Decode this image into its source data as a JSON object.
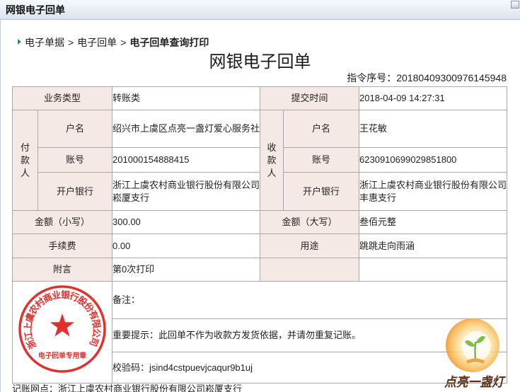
{
  "window": {
    "title": "网银电子回单",
    "control_icon": "window-control-icon"
  },
  "breadcrumb": {
    "items": [
      "电子单据",
      "电子回单"
    ],
    "separator": ">",
    "current": "电子回单查询打印"
  },
  "receipt": {
    "title": "网银电子回单",
    "instruction_label": "指令序号：",
    "instruction_no": "20180409300976145948",
    "business_type": {
      "label": "业务类型",
      "value": "转账类"
    },
    "submit_time": {
      "label": "提交时间",
      "value": "2018-04-09 14:27:31"
    },
    "payer": {
      "label": "付款人",
      "name_label": "户名",
      "name": "绍兴市上虞区点亮一盏灯爱心服务社",
      "account_label": "账号",
      "account": "201000154888415",
      "bank_label": "开户银行",
      "bank": "浙江上虞农村商业银行股份有限公司崧厦支行"
    },
    "payee": {
      "label": "收款人",
      "name_label": "户名",
      "name": "王花敏",
      "account_label": "账号",
      "account": "6230910699029851800",
      "bank_label": "开户银行",
      "bank": "浙江上虞农村商业银行股份有限公司丰惠支行"
    },
    "amount_lower": {
      "label": "金额（小写）",
      "value": "300.00"
    },
    "amount_upper": {
      "label": "金额（大写）",
      "value": "叁佰元整"
    },
    "fee": {
      "label": "手续费",
      "value": "0.00"
    },
    "purpose": {
      "label": "用途",
      "value": "跳跳走向雨涵"
    },
    "postscript": {
      "label": "附言",
      "value": "第0次打印"
    },
    "remark_label": "备注：",
    "notice": "重要提示：此回单不作为收款方发货依据，并请勿重复记账。",
    "check_code_label": "校验码：",
    "check_code": "jsind4cstpuevjcaqur9b1uj",
    "seal": {
      "ring_text": "浙江上虞农村商业银行股份有限公司",
      "center_text": "电子回单专用章"
    },
    "branch_label": "记账网点：",
    "branch": "浙江上虞农村商业银行股份有限公司崧厦支行"
  },
  "watermark": {
    "text": "点亮一盏灯"
  },
  "colors": {
    "label_bg": "#f5e9e5",
    "border": "#a8a8a8",
    "seal_red": "#e0201c",
    "breadcrumb_arrow": "#1f8a99",
    "watermark_orange": "#f2a23a"
  }
}
